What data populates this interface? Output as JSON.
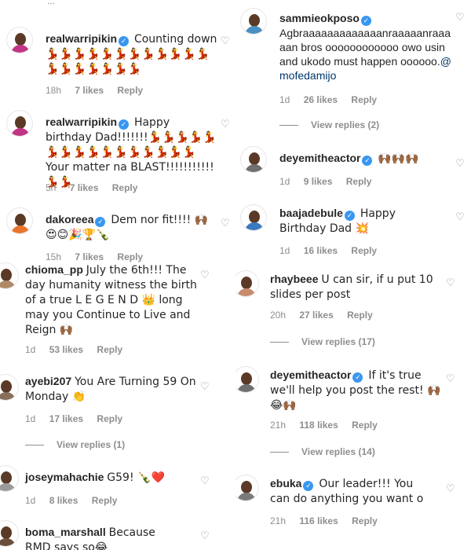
{
  "heart_glyph": "♡",
  "verified_glyph": "✓",
  "reply_label": "Reply",
  "left": {
    "top_fragment": "...",
    "comments": [
      {
        "user": "realwarripikin",
        "verified": true,
        "text": "Counting down 💃💃💃💃💃💃💃💃💃💃💃💃💃💃💃💃💃💃💃",
        "time": "18h",
        "likes": "7 likes",
        "avatar_color": "#c13584"
      },
      {
        "user": "realwarripikin",
        "verified": true,
        "text": "Happy birthday Dad!!!!!!!💃💃💃💃💃💃💃💃💃💃💃💃💃💃💃💃 Your matter na BLAST!!!!!!!!!!!💃💃",
        "time": "5h",
        "likes": "7 likes",
        "avatar_color": "#c13584"
      },
      {
        "user": "dakoreea",
        "verified": true,
        "text": "Dem nor fit!!!! 🙌🏾😍😊🎉🏆🍾",
        "time": "15h",
        "likes": "7 likes",
        "avatar_color": "#e8742a"
      },
      {
        "user": "chioma_pp",
        "verified": false,
        "text": "July the 6th!!! The day humanity witness the birth of a true L E G E N D 👑 long may you Continue to Live and Reign 🙌🏾",
        "time": "1d",
        "likes": "53 likes",
        "avatar_color": "#b08968"
      },
      {
        "user": "ayebi207",
        "verified": false,
        "text": "You Are Turning 59 On Monday 👏",
        "time": "1d",
        "likes": "17 likes",
        "avatar_color": "#8a6e5c",
        "view_replies": "View replies (1)"
      },
      {
        "user": "joseymahachie",
        "verified": false,
        "text": "G59! 🍾❤️",
        "time": "1d",
        "likes": "8 likes",
        "avatar_color": "#9a9a9a"
      },
      {
        "user": "boma_marshall",
        "verified": false,
        "text": "Because RMD says so😂",
        "time": "",
        "likes": "",
        "avatar_color": "#6b4f3a"
      }
    ]
  },
  "right": {
    "comments": [
      {
        "user": "sammieokposo",
        "verified": true,
        "text": "Agbraaaaaaaaaaaaanraaaaanraaaaan bros oooooooooooo owo usin and ukodo must happen oooooo.",
        "mention": "@mofedamijo",
        "time": "1d",
        "likes": "26 likes",
        "avatar_color": "#4a90c2",
        "view_replies": "View replies (2)"
      },
      {
        "user": "deyemitheactor",
        "verified": true,
        "text": "🙌🏾🙌🏾🙌🏾",
        "time": "1d",
        "likes": "9 likes",
        "avatar_color": "#6f6f6f"
      },
      {
        "user": "baajadebule",
        "verified": true,
        "text": "Happy Birthday Dad 💥",
        "time": "1d",
        "likes": "16 likes",
        "avatar_color": "#3a7bbf"
      },
      {
        "user": "rhaybeee",
        "verified": false,
        "text": "U can sir, if u put 10 slides per post",
        "time": "20h",
        "likes": "27 likes",
        "avatar_color": "#c98b6e",
        "view_replies": "View replies (17)"
      },
      {
        "user": "deyemitheactor",
        "verified": true,
        "text": "If it's true we'll help you post the rest! 🙌🏾😂🙌🏾",
        "time": "21h",
        "likes": "118 likes",
        "avatar_color": "#6f6f6f",
        "view_replies": "View replies (14)"
      },
      {
        "user": "ebuka",
        "verified": true,
        "text": "Our leader!!! You can do anything you want o",
        "time": "21h",
        "likes": "116 likes",
        "avatar_color": "#7a7a7a"
      }
    ]
  }
}
